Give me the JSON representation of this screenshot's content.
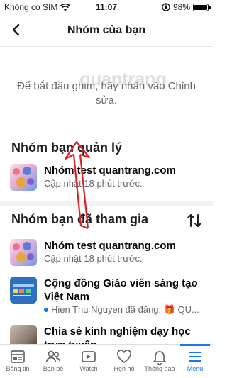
{
  "status_bar": {
    "carrier": "Không có SIM",
    "time": "11:07",
    "battery_percent": "98%",
    "battery_level": 0.98
  },
  "header": {
    "title": "Nhóm của bạn",
    "back_icon": "chevron-left-icon"
  },
  "empty_message": "Để bắt đầu ghim, hãy nhấn vào Chỉnh sửa.",
  "watermark": "quantrang",
  "managed_section": {
    "title": "Nhóm bạn quản lý",
    "groups": [
      {
        "name": "Nhóm test quantrang.com",
        "meta": "Cập nhật 18 phút trước."
      }
    ]
  },
  "joined_section": {
    "title": "Nhóm bạn đã tham gia",
    "sort_icon": "sort-arrows-icon",
    "groups": [
      {
        "name": "Nhóm test quantrang.com",
        "meta": "Cập nhật 18 phút trước."
      },
      {
        "name": "Cộng đồng Giáo viên sáng tạo Việt Nam",
        "meta": "Hien Thu Nguyen đã đăng: 🎁 QU..."
      },
      {
        "name": "Chia sẻ kinh nghiệm dạy học trực tuyến",
        "meta": ""
      }
    ]
  },
  "tabbar": {
    "items": [
      {
        "label": "Bảng tin",
        "icon": "home-icon"
      },
      {
        "label": "Bạn bè",
        "icon": "friends-icon"
      },
      {
        "label": "Watch",
        "icon": "watch-icon"
      },
      {
        "label": "Hẹn hò",
        "icon": "heart-icon"
      },
      {
        "label": "Thông báo",
        "icon": "bell-icon"
      },
      {
        "label": "Menu",
        "icon": "menu-icon"
      }
    ],
    "active": "Menu"
  },
  "colors": {
    "accent": "#1877f2",
    "annotation_arrow": "#e02020",
    "secondary_text": "#65676b"
  }
}
